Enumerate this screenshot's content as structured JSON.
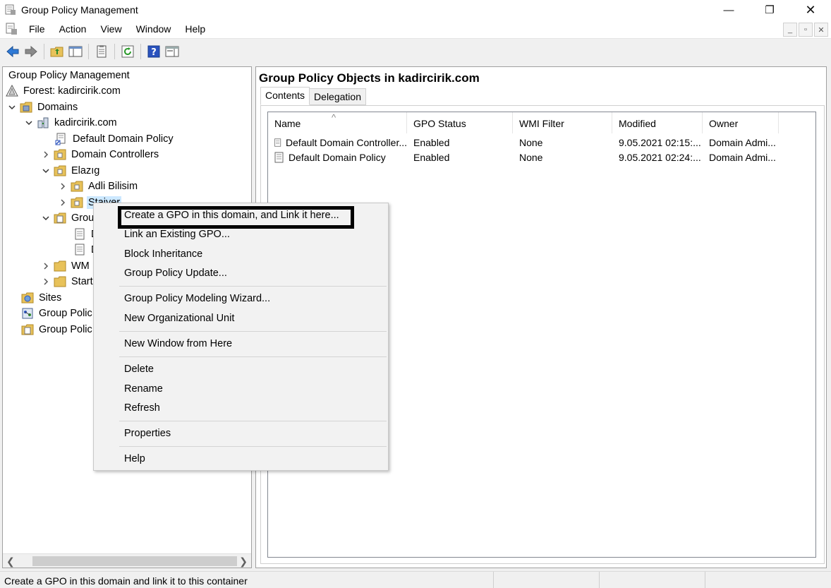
{
  "window": {
    "title": "Group Policy Management",
    "minimize": "—",
    "maximize": "❐",
    "close": "✕"
  },
  "menu": {
    "items": [
      "File",
      "Action",
      "View",
      "Window",
      "Help"
    ],
    "mdi": [
      "_",
      "▫",
      "✕"
    ]
  },
  "toolbar": {
    "buttons": [
      "back-icon",
      "forward-icon",
      "up-folder-icon",
      "show-tree-icon",
      "properties-icon",
      "refresh-icon",
      "help-icon",
      "action-pane-icon"
    ]
  },
  "tree": {
    "root": "Group Policy Management",
    "forest": "Forest: kadircirik.com",
    "domains": "Domains",
    "domain": "kadircirik.com",
    "default_domain_policy": "Default Domain Policy",
    "domain_controllers": "Domain Controllers",
    "elazig": "Elazıg",
    "adli_bilisim": "Adli Bilisim",
    "stajyer": "Stajyer",
    "group_policy_objects": "Grou",
    "gpo_child1": "D",
    "gpo_child2": "D",
    "wmi": "WM",
    "starter": "Start",
    "sites": "Sites",
    "modeling": "Group Polic",
    "results": "Group Polic"
  },
  "right_pane": {
    "title": "Group Policy Objects in kadircirik.com",
    "tabs": [
      "Contents",
      "Delegation"
    ],
    "columns": [
      "Name",
      "GPO Status",
      "WMI Filter",
      "Modified",
      "Owner"
    ],
    "rows": [
      {
        "name": "Default Domain Controller...",
        "status": "Enabled",
        "wmi": "None",
        "modified": "9.05.2021 02:15:...",
        "owner": "Domain Admi..."
      },
      {
        "name": "Default Domain Policy",
        "status": "Enabled",
        "wmi": "None",
        "modified": "9.05.2021 02:24:...",
        "owner": "Domain Admi..."
      }
    ]
  },
  "context_menu": {
    "items": [
      "Create a GPO in this domain, and Link it here...",
      "Link an Existing GPO...",
      "Block Inheritance",
      "Group Policy Update...",
      "Group Policy Modeling Wizard...",
      "New Organizational Unit",
      "New Window from Here",
      "Delete",
      "Rename",
      "Refresh",
      "Properties",
      "Help"
    ]
  },
  "statusbar": {
    "text": "Create a GPO in this domain and link it to this container"
  },
  "colors": {
    "folder": "#e8c25a",
    "selection": "#cce8ff",
    "highlight_border": "#000000"
  }
}
